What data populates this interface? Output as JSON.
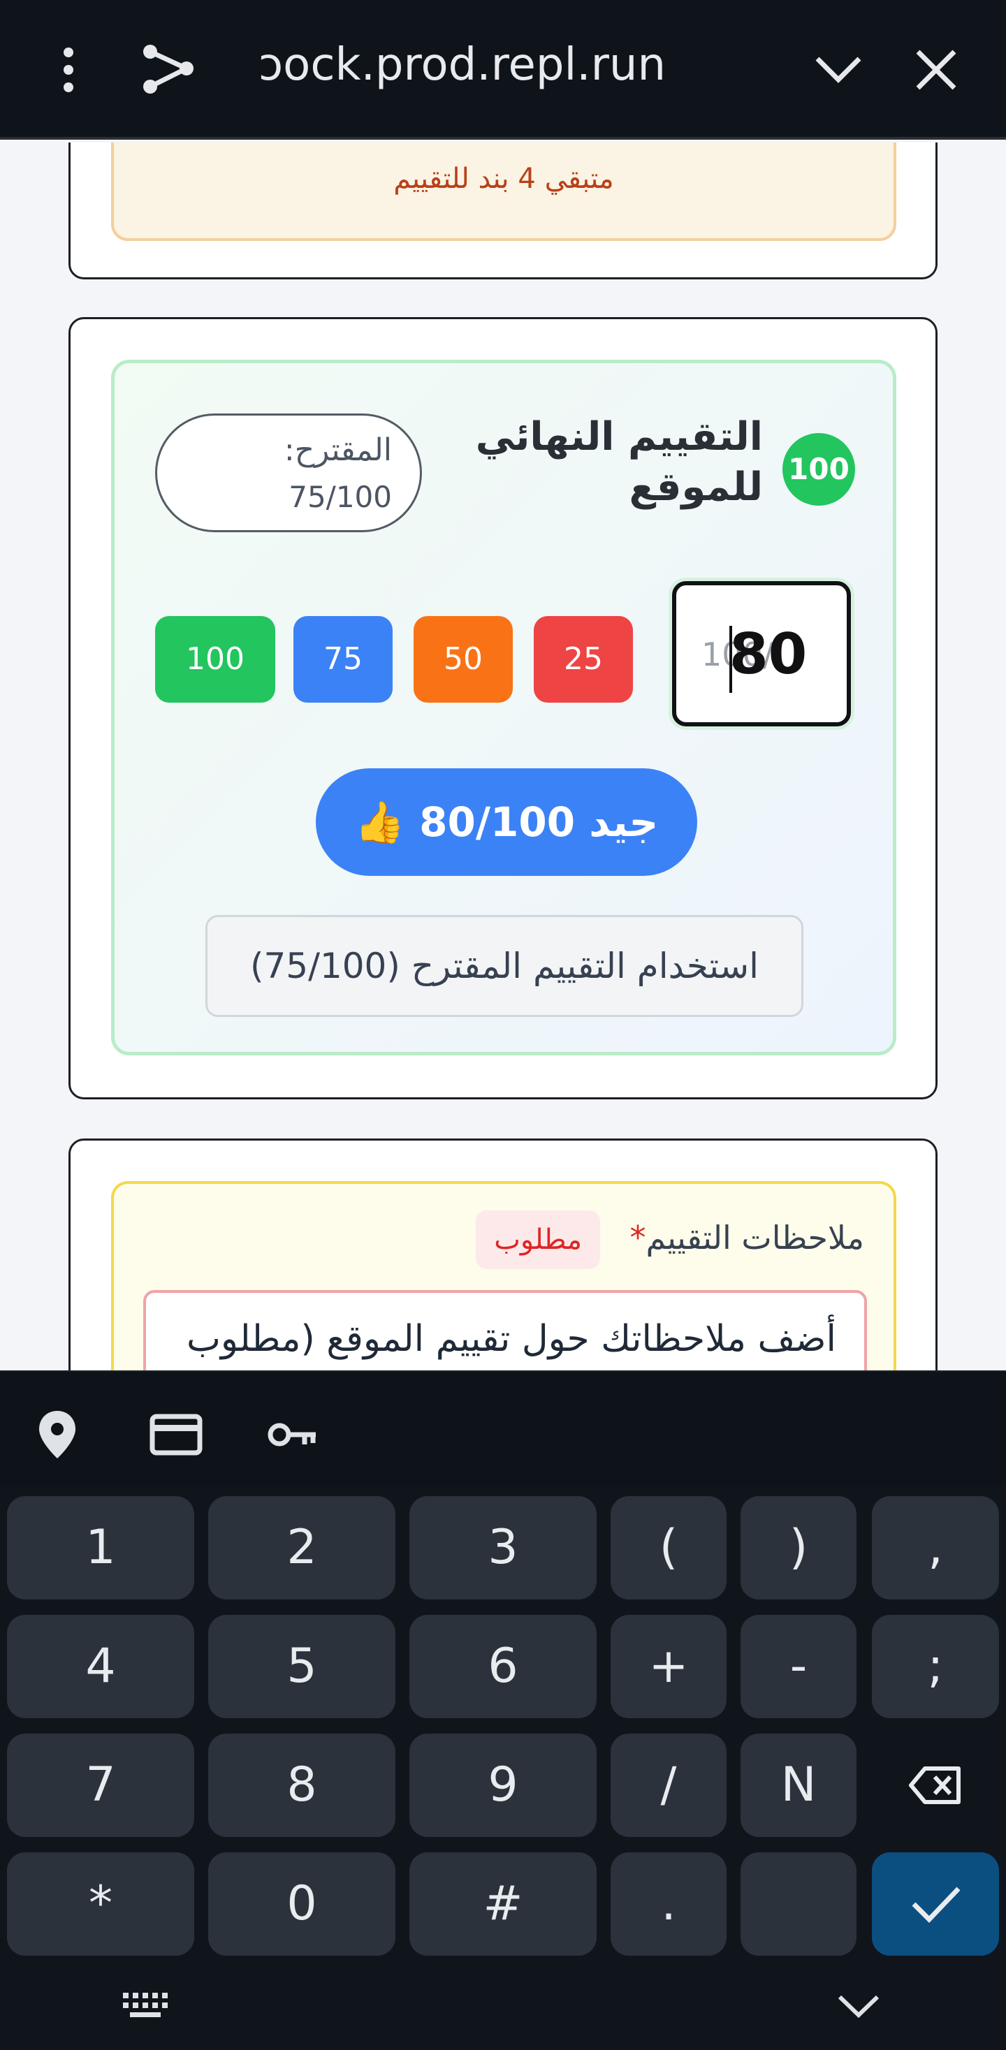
{
  "browser": {
    "url": "ɔock.prod.repl.run"
  },
  "warning": {
    "remaining_text": "متبقي 4 بند للتقييم"
  },
  "final_grade": {
    "badge": "100",
    "title": "التقييم النهائي للموقع",
    "suggested_label": "المقترح:",
    "suggested_value": "75/100",
    "input_placeholder": "100/",
    "input_value": "80",
    "quick_buttons": [
      "100",
      "75",
      "50",
      "25"
    ],
    "quick_colors": [
      "#22c55e",
      "#3b82f6",
      "#f97316",
      "#ef4444"
    ],
    "result_text": "👍 جيد  80/100",
    "use_suggested_button": "استخدام التقييم المقترح (75/100)"
  },
  "notes": {
    "title": "ملاحظات التقييم",
    "required_star": "*",
    "required_badge": "مطلوب",
    "placeholder": "أضف ملاحظاتك حول تقييم الموقع (مطلوب"
  },
  "keyboard": {
    "toolbar_icons": [
      "location-pin-icon",
      "credit-card-icon",
      "key-icon"
    ],
    "rows": [
      [
        "1",
        "2",
        "3",
        "(",
        ")",
        ","
      ],
      [
        "4",
        "5",
        "6",
        "+",
        "-",
        ";"
      ],
      [
        "7",
        "8",
        "9",
        "/",
        "N",
        "⌫"
      ],
      [
        "*",
        "0",
        "#",
        ".",
        " ",
        "✓"
      ]
    ],
    "done_color": "#0b4f80"
  }
}
